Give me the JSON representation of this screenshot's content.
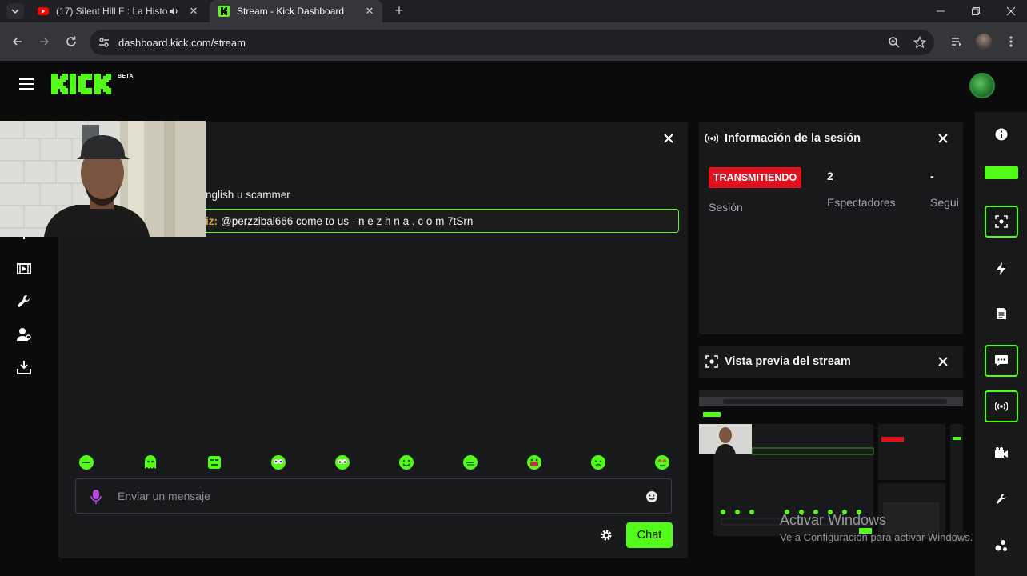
{
  "browser": {
    "tabs": [
      {
        "title": "(17) Silent Hill F : La Historia",
        "active": false,
        "favicon": "youtube-icon",
        "audio": true
      },
      {
        "title": "Stream - Kick Dashboard",
        "active": true,
        "favicon": "kick-icon"
      }
    ],
    "url": "dashboard.kick.com/stream"
  },
  "header": {
    "logo_text": "KICK",
    "beta_label": "BETA"
  },
  "chat": {
    "partial_message": "nglish u scammer",
    "pinned": {
      "user_fragment": "iz:",
      "text": "@perzzibal666 come to us - n e z h n a . c o m 7tSrn"
    },
    "input_placeholder": "Enviar un mensaje",
    "send_label": "Chat"
  },
  "session": {
    "title": "Información de la sesión",
    "status_badge": "TRANSMITIENDO",
    "session_label": "Sesión",
    "viewers_value": "2",
    "viewers_label": "Espectadores",
    "followers_value": "-",
    "followers_label": "Segui"
  },
  "preview": {
    "title": "Vista previa del stream"
  },
  "os_watermark": {
    "line1": "Activar Windows",
    "line2": "Ve a Configuración para activar Windows."
  },
  "colors": {
    "accent": "#53fc18",
    "live": "#e0101f",
    "panel": "#18191b",
    "background": "#0b0b0c"
  }
}
